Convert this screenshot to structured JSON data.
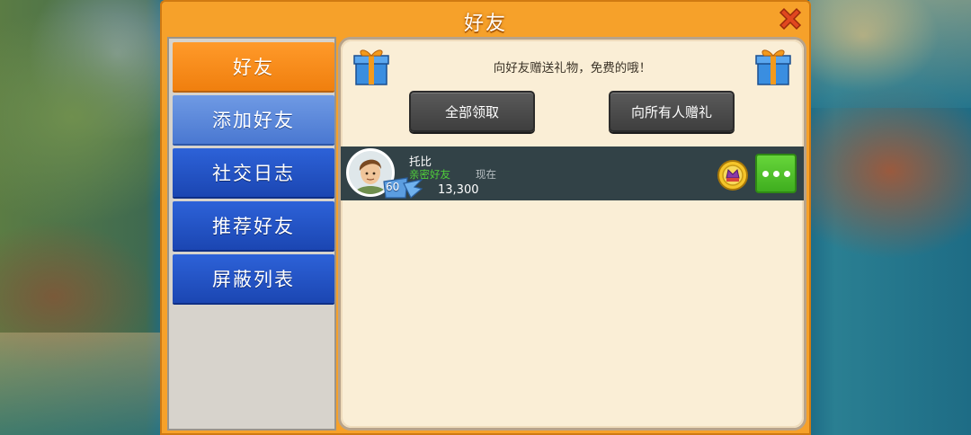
{
  "dialog": {
    "title": "好友",
    "close_icon": "close-x-icon"
  },
  "sidebar": {
    "items": [
      {
        "label": "好友",
        "state": "active"
      },
      {
        "label": "添加好友",
        "state": "light"
      },
      {
        "label": "社交日志",
        "state": "normal"
      },
      {
        "label": "推荐好友",
        "state": "normal"
      },
      {
        "label": "屏蔽列表",
        "state": "normal"
      }
    ]
  },
  "content": {
    "gift_message": "向好友赠送礼物，免费的哦！",
    "claim_all_label": "全部领取",
    "send_all_label": "向所有人赠礼",
    "friends": [
      {
        "name": "托比",
        "level": "60",
        "relation": "亲密好友",
        "status": "现在",
        "score": "13,300",
        "rank_icon": "rank-badge-icon",
        "more_icon": "more-options-icon"
      }
    ]
  },
  "colors": {
    "frame_orange": "#f6a12a",
    "tab_active": "#f07f0e",
    "tab_blue": "#1b46b2",
    "panel_bg": "#faeed6",
    "row_bg": "#324247",
    "relation_green": "#4fcf3a",
    "more_button_green": "#3fae1f"
  }
}
